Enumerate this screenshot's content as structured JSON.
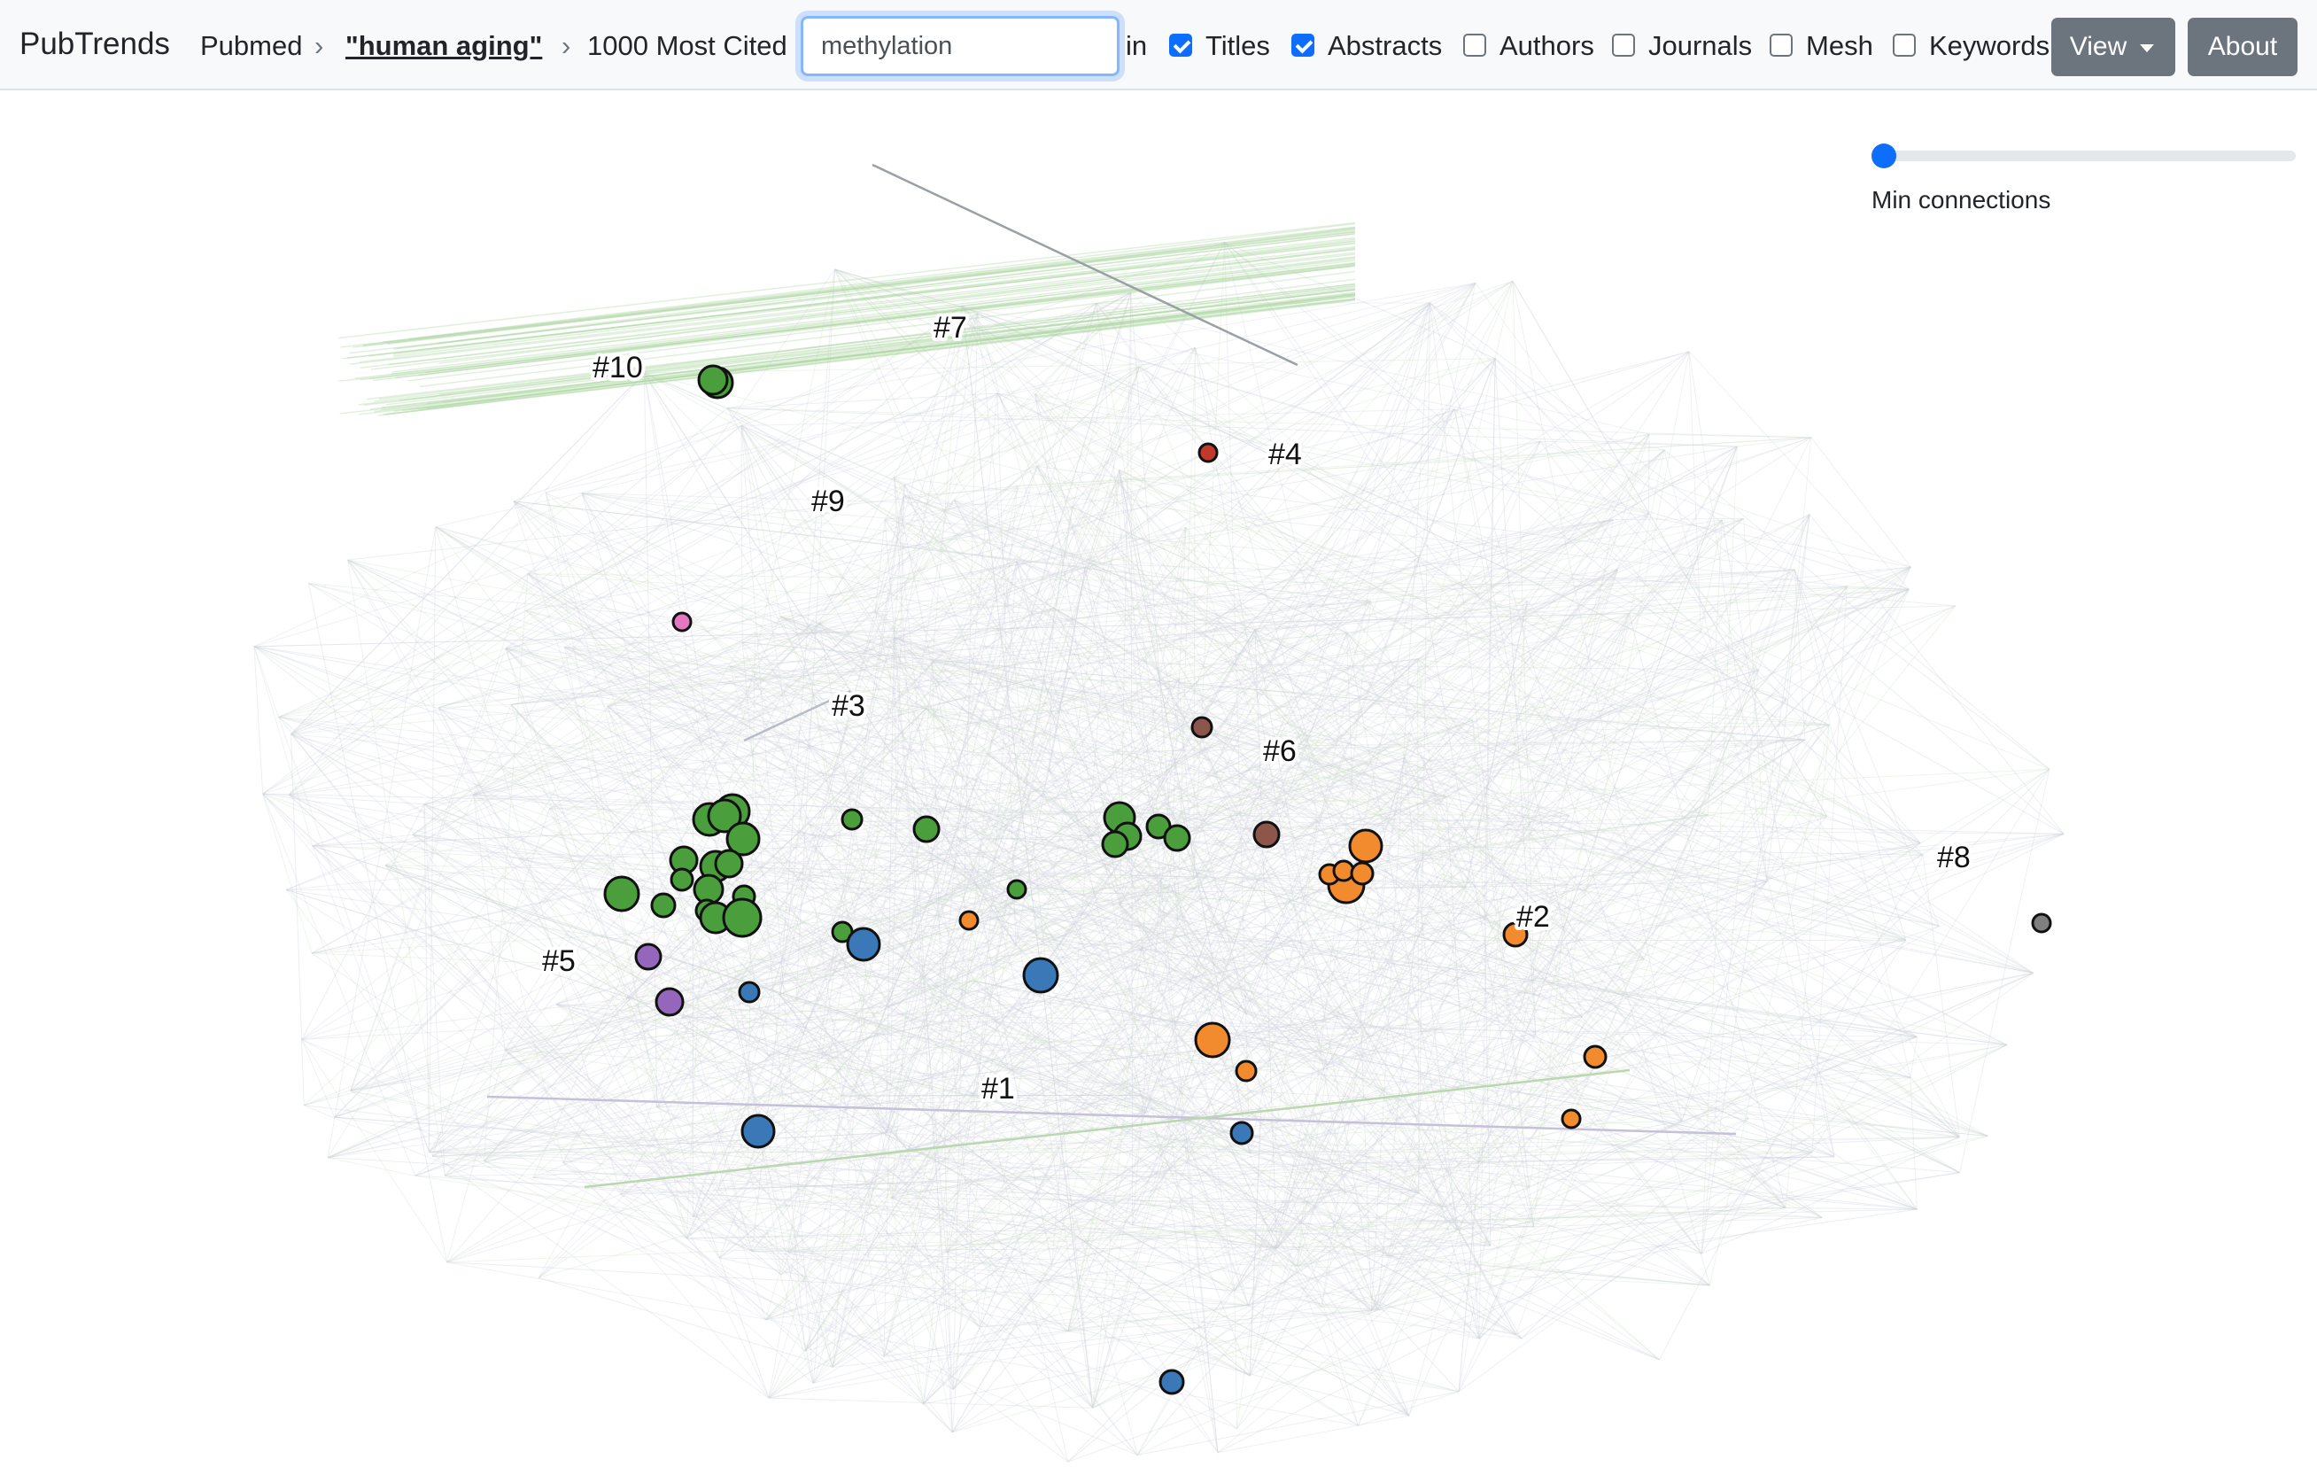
{
  "navbar": {
    "brand": "PubTrends",
    "breadcrumb_source": "Pubmed",
    "breadcrumb_query": "\"human aging\"",
    "breadcrumb_mode": "1000 Most Cited",
    "search_value": "methylation",
    "in_label": "in",
    "filters": [
      {
        "label": "Titles",
        "checked": true
      },
      {
        "label": "Abstracts",
        "checked": true
      },
      {
        "label": "Authors",
        "checked": false
      },
      {
        "label": "Journals",
        "checked": false
      },
      {
        "label": "Mesh",
        "checked": false
      },
      {
        "label": "Keywords",
        "checked": false
      }
    ],
    "view_button": "View",
    "about_button": "About"
  },
  "graph": {
    "cluster_labels": [
      "#1",
      "#2",
      "#3",
      "#4",
      "#5",
      "#6",
      "#7",
      "#8",
      "#9",
      "#10"
    ],
    "cluster_colors": {
      "1": "#3b78b8",
      "2": "#f28a2e",
      "3": "#4a9e3c",
      "4": "#c0392b",
      "5": "#9467bd",
      "6": "#8c564b",
      "7": "#e377c2",
      "8": "#7f7f7f",
      "9": "#bcbd22",
      "10": "#17becf"
    },
    "slider": {
      "label": "Min connections",
      "value": 0
    }
  }
}
